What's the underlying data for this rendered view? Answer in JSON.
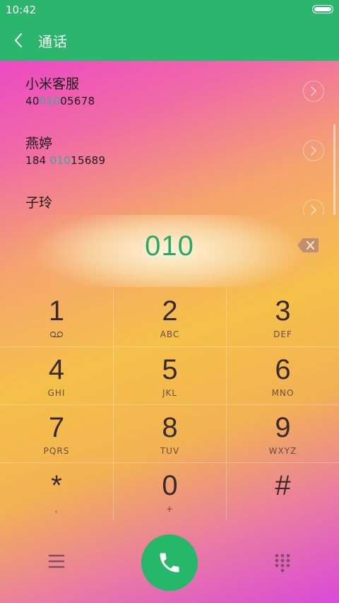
{
  "status": {
    "time": "10:42"
  },
  "app_bar": {
    "title": "通话"
  },
  "contacts": [
    {
      "name": "小米客服",
      "number_pre": "40",
      "number_match": "010",
      "number_post": "05678"
    },
    {
      "name": "燕婷",
      "number_pre": "184 ",
      "number_match": "010",
      "number_post": "15689"
    },
    {
      "name": "子玲",
      "number_pre": "",
      "number_match": "",
      "number_post": ""
    }
  ],
  "dialed_number": "010",
  "keys": [
    {
      "digit": "1",
      "letters": ""
    },
    {
      "digit": "2",
      "letters": "ABC"
    },
    {
      "digit": "3",
      "letters": "DEF"
    },
    {
      "digit": "4",
      "letters": "GHI"
    },
    {
      "digit": "5",
      "letters": "JKL"
    },
    {
      "digit": "6",
      "letters": "MNO"
    },
    {
      "digit": "7",
      "letters": "PQRS"
    },
    {
      "digit": "8",
      "letters": "TUV"
    },
    {
      "digit": "9",
      "letters": "WXYZ"
    },
    {
      "digit": "*",
      "letters": ","
    },
    {
      "digit": "0",
      "letters": "+"
    },
    {
      "digit": "#",
      "letters": ""
    }
  ],
  "icons": {
    "back": "chevron-left-icon",
    "voicemail": "voicemail-icon",
    "backspace": "backspace-icon",
    "menu": "menu-icon",
    "call": "phone-icon",
    "dialpad": "dialpad-icon"
  },
  "colors": {
    "accent": "#2bb56d",
    "dialed_text": "#27a86a",
    "match_highlight": "#3aa8a0",
    "call_button": "#25b86a"
  }
}
